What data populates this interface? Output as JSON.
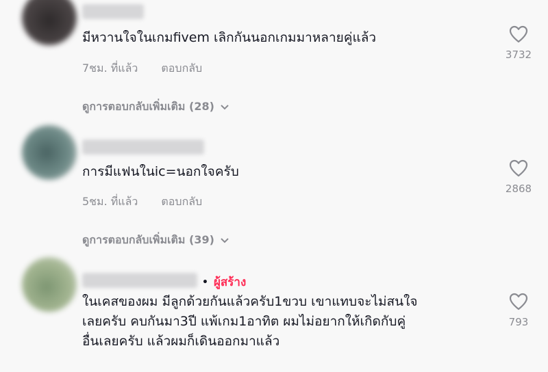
{
  "comments": [
    {
      "text_lines": [
        "มีหวานใจในเกมfivem เลิกกันนอกเกมมาหลายคู่แล้ว"
      ],
      "time": "7ชม. ที่แล้ว",
      "reply_label": "ตอบกลับ",
      "likes": "3732",
      "view_replies": "ดูการตอบกลับเพิ่มเติม (28)",
      "avatar_color": "#3a3637"
    },
    {
      "text_lines": [
        "การมีแฟนในic=นอกใจครับ"
      ],
      "time": "5ชม. ที่แล้ว",
      "reply_label": "ตอบกลับ",
      "likes": "2868",
      "view_replies": "ดูการตอบกลับเพิ่มเติม (39)",
      "avatar_color": "#5f7a78"
    },
    {
      "creator_badge": "ผู้สร้าง",
      "text_lines": [
        "ในเคสของผม มีลูกด้วยกันแล้วครับ1ขวบ เขาแทบจะไม่สนใจ",
        "เลยครับ คบกันมา3ปี แพ้เกม1อาทิต ผมไม่อยากให้เกิดกับคู่",
        "อื่นเลยครับ แล้วผมก็เดินออกมาแล้ว"
      ],
      "likes": "793",
      "avatar_color": "#8fa37f"
    }
  ],
  "colors": {
    "creator_accent": "#fe2c55",
    "secondary_text": "#8a8b91"
  },
  "icons": {
    "like": "heart-outline-icon",
    "expand": "chevron-down-icon"
  }
}
